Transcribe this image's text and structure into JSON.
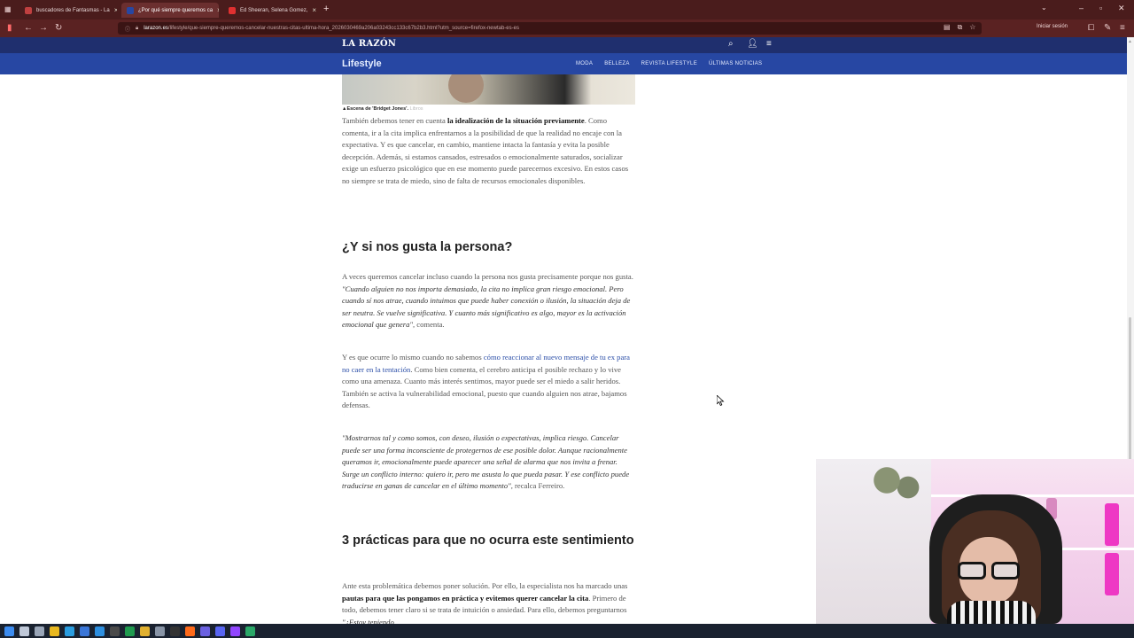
{
  "browser": {
    "tabs": [
      {
        "title": "buscadores de Fantasmas - La",
        "color": "#c04040",
        "active": false
      },
      {
        "title": "¿Por qué siempre queremos ca",
        "color": "#2747a3",
        "active": true
      },
      {
        "title": "Ed Sheeran, Selena Gomez,",
        "color": "#e03030",
        "active": false
      }
    ],
    "new_tab": "+",
    "url_domain": "larazon.es",
    "url_path": "/lifestyle/que-siempre-queremos-cancelar-nuestras-citas-ultima-hora_2026030469a206a03243cc133c67b2b3.html?utm_source=firefox-newtab-es-es",
    "sign_in": "Iniciar sesión"
  },
  "site": {
    "logo": "LA RAZÓN",
    "section": "Lifestyle",
    "nav": [
      "MODA",
      "BELLEZA",
      "REVISTA LIFESTYLE",
      "ÚLTIMAS NOTICIAS"
    ],
    "brand_color": "#2747a3"
  },
  "article": {
    "caption": "▲Escena de 'Bridget Jones'.",
    "caption_credit": "Libros",
    "p1": {
      "a": "También debemos tener en cuenta ",
      "b": "la idealización de la situación previamente",
      "c": ". Como comenta, ir a la cita implica enfrentarnos a la posibilidad de que la realidad no encaje con la expectativa. Y es que cancelar, en cambio, mantiene intacta la fantasía y evita la posible decepción. Además, si estamos cansados, estresados o emocionalmente saturados, socializar exige un esfuerzo psicológico que en ese momento puede parecernos excesivo. En estos casos no siempre se trata de miedo, sino de falta de recursos emocionales disponibles."
    },
    "h1": "¿Y si nos gusta la persona?",
    "p2": {
      "a": "A veces queremos cancelar incluso cuando la persona nos gusta precisamente porque nos gusta. ",
      "quote": "\"Cuando alguien no nos importa demasiado, la cita no implica gran riesgo emocional. Pero cuando sí nos atrae, cuando intuimos que puede haber conexión o ilusión, la situación deja de ser neutra. Se vuelve significativa. Y cuanto más significativo es algo, mayor es la activación emocional que genera\"",
      "c": ", comenta."
    },
    "p3": {
      "a": "Y es que ocurre lo mismo cuando no sabemos ",
      "link": "cómo reaccionar al nuevo mensaje de tu ex para no caer en la tentación",
      "c": ". Como bien comenta, el cerebro anticipa el posible rechazo y lo vive como una amenaza. Cuanto más interés sentimos, mayor puede ser el miedo a salir heridos. También se activa la vulnerabilidad emocional, puesto que cuando alguien nos atrae, bajamos defensas."
    },
    "p4": {
      "quote": "\"Mostrarnos tal y como somos, con deseo, ilusión o expectativas, implica riesgo. Cancelar puede ser una forma inconsciente de protegernos de ese posible dolor. Aunque racionalmente queramos ir, emocionalmente puede aparecer una señal de alarma que nos invita a frenar. Surge un conflicto interno: quiero ir, pero me asusta lo que pueda pasar. Y ese conflicto puede traducirse en ganas de cancelar en el último momento\"",
      "c": ", recalca Ferreiro."
    },
    "h2": "3 prácticas para que no ocurra este sentimiento",
    "p5": {
      "a": "Ante esta problemática debemos poner solución. Por ello, la especialista nos ha marcado unas ",
      "b": "pautas para que las pongamos en práctica y evitemos querer cancelar la cita",
      "c": ". Primero de todo, debemos tener claro si se trata de intuición o ansiedad. Para ello, debemos preguntarnos ",
      "quote": "\"¿Estoy teniendo"
    }
  },
  "taskbar": {
    "icons": [
      "windows-icon",
      "search-icon",
      "task-view-icon",
      "folder-icon",
      "edge-icon",
      "store-icon",
      "vscode-icon",
      "terminal-icon",
      "excel-icon",
      "chrome-icon",
      "settings-icon",
      "obs-icon",
      "firefox-icon",
      "app-icon",
      "discord-icon",
      "twitch-icon",
      "app2-icon"
    ],
    "icon_colors": [
      "#3c8cf0",
      "#bfc8d8",
      "#9aa6b8",
      "#e8b820",
      "#2a9de0",
      "#3a76d8",
      "#2d8fe0",
      "#4a4a4a",
      "#1f9a4e",
      "#e0b030",
      "#8894a6",
      "#333333",
      "#ff6a1a",
      "#6a60e0",
      "#5865f2",
      "#9146ff",
      "#2aa868"
    ]
  }
}
